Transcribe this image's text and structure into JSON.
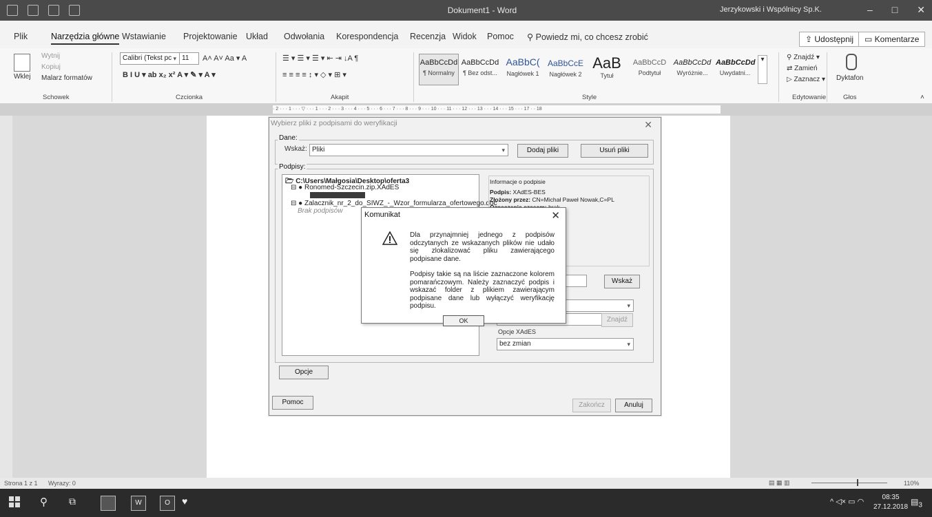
{
  "window": {
    "title": "Dokument1 - Word",
    "user": "Jerzykowski i Wspólnicy Sp.K."
  },
  "tabs": [
    "Plik",
    "Narzędzia główne",
    "Wstawianie",
    "Projektowanie",
    "Układ",
    "Odwołania",
    "Korespondencja",
    "Recenzja",
    "Widok",
    "Pomoc"
  ],
  "tell_me": "Powiedz mi, co chcesz zrobić",
  "share_label": "Udostępnij",
  "comments_label": "Komentarze",
  "ribbon": {
    "clipboard": {
      "paste": "Wklej",
      "cut": "Wytnij",
      "copy": "Kopiuj",
      "format_painter": "Malarz formatów",
      "label": "Schowek"
    },
    "font": {
      "name": "Calibri (Tekst pc",
      "size": "11",
      "label": "Czcionka"
    },
    "paragraph": {
      "label": "Akapit"
    },
    "styles": {
      "label": "Style",
      "items": [
        {
          "preview": "AaBbCcDd",
          "name": "¶ Normalny"
        },
        {
          "preview": "AaBbCcDd",
          "name": "¶ Bez odst..."
        },
        {
          "preview": "AaBbC(",
          "name": "Nagłówek 1"
        },
        {
          "preview": "AaBbCcE",
          "name": "Nagłówek 2"
        },
        {
          "preview": "AaB",
          "name": "Tytuł"
        },
        {
          "preview": "AaBbCcD",
          "name": "Podtytuł"
        },
        {
          "preview": "AaBbCcDd",
          "name": "Wyróżnie..."
        },
        {
          "preview": "AaBbCcDd",
          "name": "Uwydatni..."
        }
      ]
    },
    "editing": {
      "find": "Znajdź",
      "replace": "Zamień",
      "select": "Zaznacz",
      "label": "Edytowanie"
    },
    "voice": {
      "dictate": "Dyktafon",
      "label": "Głos"
    }
  },
  "ruler_text": "· 2 · · · 1 · · · ▽ · · · 1 · · · 2 · · · 3 · · · 4 · · · 5 · · · 6 · · · 7 · · · 8 · · · 9 · · · 10 · · · 11 · · · 12 · · · 13 · · · 14 · · · 15 · · · 17 · · 18",
  "status": {
    "page": "Strona 1 z 1",
    "words": "Wyrazy: 0",
    "zoom": "110%"
  },
  "taskbar": {
    "time": "08:35",
    "date": "27.12.2018",
    "notif": "3"
  },
  "dialog": {
    "title": "Wybierz pliki z podpisami do weryfikacji",
    "dane_legend": "Dane:",
    "wskaz_label": "Wskaż:",
    "wskaz_value": "Pliki",
    "add_files": "Dodaj pliki",
    "remove_files": "Usuń pliki",
    "podpisy_legend": "Podpisy:",
    "tree": [
      "C:\\Users\\Małgosia\\Desktop\\oferta3",
      "Ronomed-Szczecin.zip.XAdES",
      "Zalacznik_nr_2_do_SIWZ_-_Wzor_formularza_ofertowego.doc",
      "Brak podpisów"
    ],
    "info": {
      "heading": "Informacje o podpisie",
      "sig_label": "Podpis:",
      "sig_value": "XAdES-BES",
      "by_label": "Złożony przez:",
      "by_value": "CN=Michał Paweł Nowak,C=PL",
      "ts_label": "Oznaczenie czasem:",
      "ts_value": "brak"
    },
    "wskaz_btn": "Wskaż",
    "znajdz_btn": "Znajdź",
    "xades_label": "Opcje XAdES",
    "xades_value": "bez zmian",
    "options_btn": "Opcje",
    "help_btn": "Pomoc",
    "finish_btn": "Zakończ",
    "cancel_btn": "Anuluj"
  },
  "message": {
    "title": "Komunikat",
    "para1": "Dla przynajmniej jednego z podpisów odczytanych ze wskazanych plików nie udało się zlokalizować pliku zawierającego podpisane dane.",
    "para2": "Podpisy takie są na liście zaznaczone kolorem pomarańczowym. Należy zaznaczyć podpis i wskazać folder z plikiem zawierającym podpisane dane lub wyłączyć weryfikację podpisu.",
    "ok": "OK"
  }
}
